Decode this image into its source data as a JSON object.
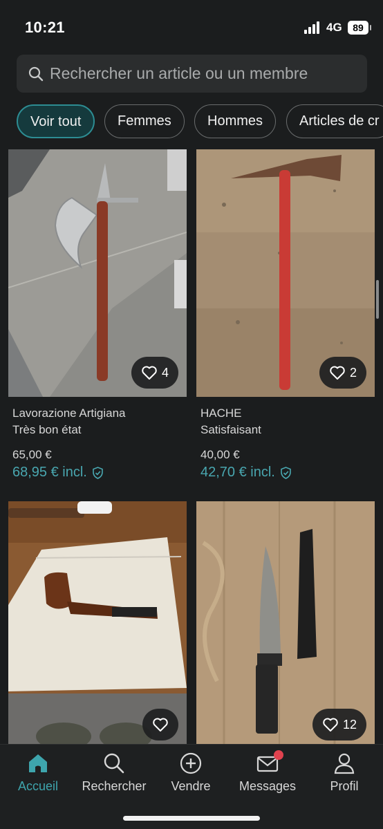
{
  "status_bar": {
    "time": "10:21",
    "network": "4G",
    "battery": "89"
  },
  "search": {
    "placeholder": "Rechercher un article ou un membre"
  },
  "chips": [
    "Voir tout",
    "Femmes",
    "Hommes",
    "Articles de cr"
  ],
  "items": [
    {
      "title": "Lavorazione Artigiana",
      "condition": "Très bon état",
      "price": "65,00 €",
      "total": "68,95 € incl.",
      "likes": "4",
      "image": "axe-photo"
    },
    {
      "title": "HACHE",
      "condition": "Satisfaisant",
      "price": "40,00 €",
      "total": "42,70 € incl.",
      "likes": "2",
      "image": "pickaxe-photo"
    },
    {
      "title": "",
      "condition": "",
      "price": "",
      "total": "",
      "likes": "",
      "image": "pipe-photo"
    },
    {
      "title": "",
      "condition": "",
      "price": "",
      "total": "",
      "likes": "12",
      "image": "knife-photo"
    }
  ],
  "tabs": [
    {
      "label": "Accueil",
      "icon": "home-icon",
      "active": true
    },
    {
      "label": "Rechercher",
      "icon": "search-icon"
    },
    {
      "label": "Vendre",
      "icon": "plus-circle-icon"
    },
    {
      "label": "Messages",
      "icon": "mail-icon",
      "badge": true
    },
    {
      "label": "Profil",
      "icon": "user-icon"
    }
  ],
  "colors": {
    "accent": "#3ea5ad",
    "background": "#1b1d1e",
    "badge": "#e0424e"
  }
}
